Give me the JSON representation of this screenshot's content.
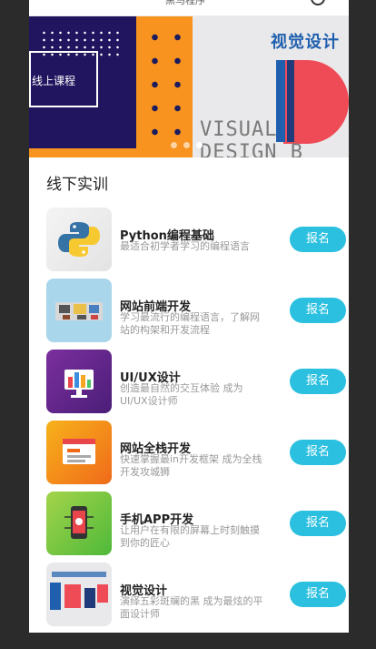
{
  "topbar": {
    "title": "黑马程序"
  },
  "banner": {
    "left_text": "线上课程",
    "right_heading": "视觉设计",
    "right_subtext": "VISUAL DESIGN B"
  },
  "section": {
    "title": "线下实训"
  },
  "courses": [
    {
      "name": "Python编程基础",
      "desc": "最适合初学者学习的编程语言",
      "button": "报名",
      "icon": "python-logo-icon"
    },
    {
      "name": "网站前端开发",
      "desc": "学习最流行的编程语言，了解网站的构架和开发流程",
      "button": "报名",
      "icon": "web-frontend-icon"
    },
    {
      "name": "UI/UX设计",
      "desc": "创造最自然的交互体验 成为UI/UX设计师",
      "button": "报名",
      "icon": "ui-design-icon"
    },
    {
      "name": "网站全栈开发",
      "desc": "快速掌握最in开发框架 成为全栈开发攻城狮",
      "button": "报名",
      "icon": "fullstack-icon"
    },
    {
      "name": "手机APP开发",
      "desc": "让用户在有限的屏幕上时刻触摸到你的匠心",
      "button": "报名",
      "icon": "mobile-app-icon"
    },
    {
      "name": "视觉设计",
      "desc": "演绎五彩斑斓的黑 成为最炫的平面设计师",
      "button": "报名",
      "icon": "visual-design-icon"
    }
  ],
  "colors": {
    "accent": "#2bc0df",
    "banner_orange": "#f7931e",
    "banner_navy": "#21155f"
  }
}
